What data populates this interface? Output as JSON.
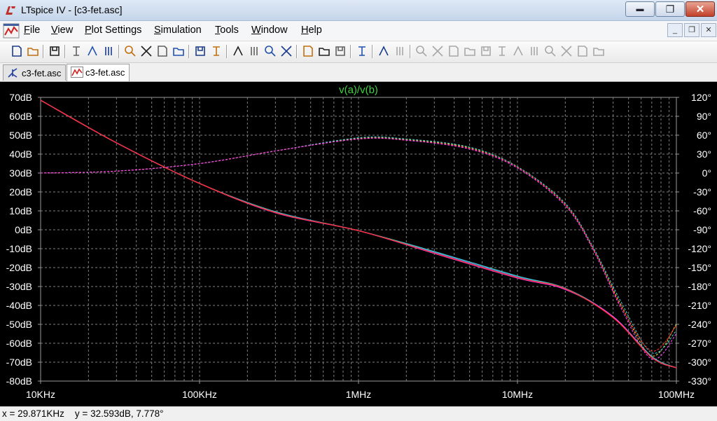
{
  "window": {
    "title": "LTspice IV - [c3-fet.asc]",
    "min_glyph": "▬",
    "max_glyph": "❐",
    "close_glyph": "✕"
  },
  "menu": [
    "File",
    "View",
    "Plot Settings",
    "Simulation",
    "Tools",
    "Window",
    "Help"
  ],
  "mdi_buttons": [
    "_",
    "❐",
    "✕"
  ],
  "toolbar_icons": [
    "new-schematic",
    "open",
    "save",
    "control-panel",
    "run",
    "halt",
    "zoom-in",
    "zoom-pan",
    "zoom-out",
    "zoom-cancel",
    "autorange",
    "mark-cursor",
    "tile-horizontal",
    "cascade",
    "close-window",
    "cut",
    "copy",
    "paste",
    "find",
    "print-setup",
    "print",
    "wire",
    "ground",
    "label",
    "resistor",
    "capacitor",
    "inductor",
    "diode",
    "component",
    "move",
    "drag",
    "undo",
    "redo",
    "rotate",
    "mirror",
    "text",
    "spice-directive"
  ],
  "tabs": [
    {
      "label": "c3-fet.asc",
      "icon": "schematic-icon",
      "active": false
    },
    {
      "label": "c3-fet.asc",
      "icon": "waveform-icon",
      "active": true
    }
  ],
  "status": {
    "text": "x = 29.871KHz    y = 32.593dB, 7.778°"
  },
  "colors": {
    "trace_red": "#ff2a2a",
    "trace_green": "#4cd24c",
    "trace_blue": "#5080ff",
    "trace_cyan": "#40c8c8",
    "trace_yellow": "#d8c832",
    "trace_magenta": "#ff40ff",
    "title": "#3fd23f",
    "grid": "#808080"
  },
  "chart_data": {
    "type": "line",
    "title": "v(a)/v(b)",
    "x_scale": "log",
    "xlim": [
      10000,
      100000000
    ],
    "ylim": [
      -80,
      70
    ],
    "y2lim": [
      -330,
      120
    ],
    "x_ticks": [
      {
        "v": 10000,
        "label": "10KHz"
      },
      {
        "v": 100000,
        "label": "100KHz"
      },
      {
        "v": 1000000,
        "label": "1MHz"
      },
      {
        "v": 10000000,
        "label": "10MHz"
      },
      {
        "v": 100000000,
        "label": "100MHz"
      }
    ],
    "y_ticks": [
      70,
      60,
      50,
      40,
      30,
      20,
      10,
      0,
      -10,
      -20,
      -30,
      -40,
      -50,
      -60,
      -70,
      -80
    ],
    "y_tick_labels": [
      "70dB",
      "60dB",
      "50dB",
      "40dB",
      "30dB",
      "20dB",
      "10dB",
      "0dB",
      "-10dB",
      "-20dB",
      "-30dB",
      "-40dB",
      "-50dB",
      "-60dB",
      "-70dB",
      "-80dB"
    ],
    "y2_ticks": [
      120,
      90,
      60,
      30,
      0,
      -30,
      -60,
      -90,
      -120,
      -150,
      -180,
      -210,
      -240,
      -270,
      -300,
      -330
    ],
    "y2_tick_labels": [
      "120°",
      "90°",
      "60°",
      "30°",
      "0°",
      "-30°",
      "-60°",
      "-90°",
      "-120°",
      "-150°",
      "-180°",
      "-210°",
      "-240°",
      "-270°",
      "-300°",
      "-330°"
    ],
    "magnitude_series": [
      {
        "color": "#5080ff",
        "x": [
          10000,
          30000,
          100000,
          300000,
          1000000,
          3000000,
          10000000,
          20000000,
          40000000,
          70000000,
          100000000
        ],
        "y": [
          68.5,
          46,
          24.5,
          9.5,
          -0.5,
          -12,
          -25,
          -31,
          -46,
          -67,
          -73
        ]
      },
      {
        "color": "#40c8c8",
        "x": [
          10000,
          30000,
          100000,
          300000,
          1000000,
          3000000,
          10000000,
          20000000,
          40000000,
          70000000,
          100000000
        ],
        "y": [
          68.5,
          46,
          24.5,
          9.5,
          -0.5,
          -11.5,
          -24.5,
          -31,
          -46,
          -67,
          -73
        ]
      },
      {
        "color": "#ff40ff",
        "x": [
          10000,
          30000,
          100000,
          300000,
          1000000,
          3000000,
          10000000,
          20000000,
          40000000,
          70000000,
          100000000
        ],
        "y": [
          68.5,
          46,
          24.5,
          9,
          -0.5,
          -12.5,
          -25.5,
          -31.5,
          -46,
          -67.5,
          -73
        ]
      },
      {
        "color": "#ff2a2a",
        "x": [
          10000,
          30000,
          100000,
          300000,
          1000000,
          3000000,
          10000000,
          20000000,
          40000000,
          70000000,
          100000000
        ],
        "y": [
          68.5,
          46,
          24.5,
          9.2,
          -0.5,
          -12.3,
          -25.3,
          -31.2,
          -46.5,
          -67.5,
          -73
        ]
      }
    ],
    "phase_series": [
      {
        "color": "#d8c832",
        "x": [
          10000,
          30000,
          100000,
          300000,
          1000000,
          2000000,
          5000000,
          10000000,
          20000000,
          30000000,
          45000000,
          70000000,
          100000000
        ],
        "y": [
          0,
          3,
          15,
          35,
          55,
          53,
          40,
          10,
          -50,
          -120,
          -210,
          -290,
          -240
        ]
      },
      {
        "color": "#40c8c8",
        "x": [
          10000,
          30000,
          100000,
          300000,
          1000000,
          2000000,
          5000000,
          10000000,
          20000000,
          30000000,
          45000000,
          70000000,
          100000000
        ],
        "y": [
          0,
          3,
          15,
          35,
          56,
          54,
          41,
          10,
          -48,
          -118,
          -205,
          -285,
          -250
        ]
      },
      {
        "color": "#ff2a2a",
        "x": [
          10000,
          30000,
          100000,
          300000,
          1000000,
          2000000,
          5000000,
          10000000,
          20000000,
          30000000,
          45000000,
          70000000,
          100000000
        ],
        "y": [
          0,
          3,
          15,
          35,
          54,
          52,
          39,
          9,
          -50,
          -120,
          -212,
          -282,
          -242
        ]
      },
      {
        "color": "#ff40ff",
        "x": [
          10000,
          30000,
          100000,
          300000,
          1000000,
          2000000,
          5000000,
          10000000,
          20000000,
          30000000,
          45000000,
          70000000,
          100000000
        ],
        "y": [
          0,
          3,
          15,
          35,
          54,
          52,
          38,
          8,
          -52,
          -122,
          -215,
          -295,
          -255
        ]
      }
    ]
  }
}
